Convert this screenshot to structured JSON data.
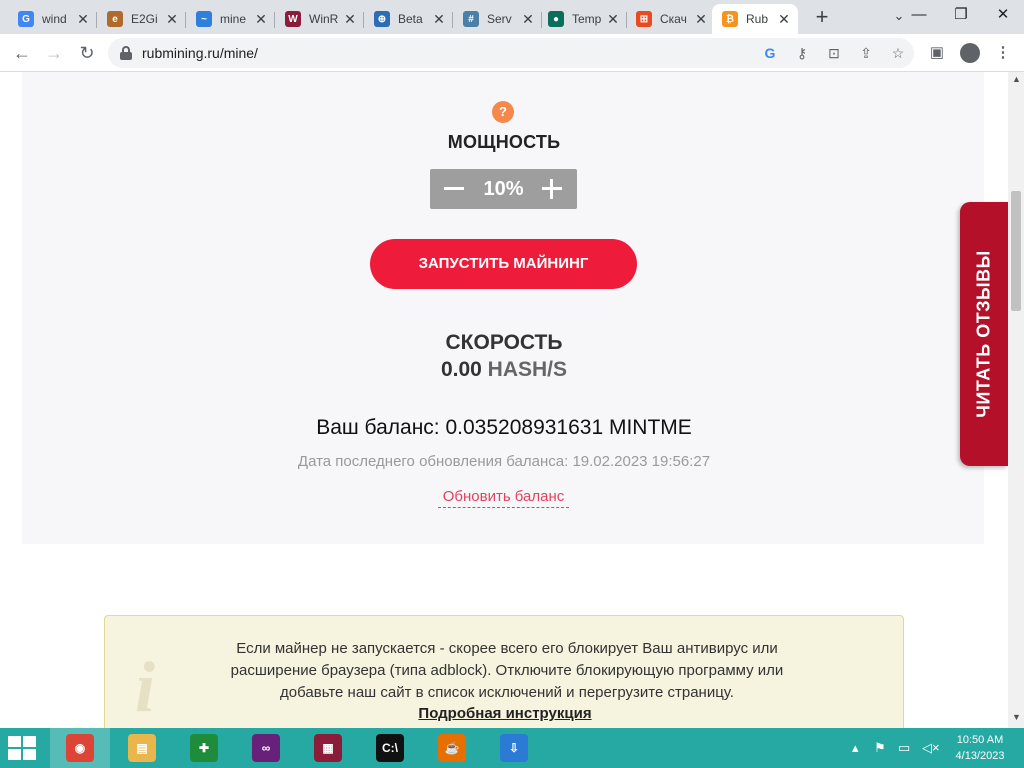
{
  "browser": {
    "tabs": [
      {
        "label": "wind",
        "favicon": "google-g-icon",
        "color": "#4285f4",
        "glyph": "G"
      },
      {
        "label": "E2Gi",
        "favicon": "globe-icon",
        "color": "#b06a2c",
        "glyph": "e"
      },
      {
        "label": "mine",
        "favicon": "swirl-icon",
        "color": "#2f7fdc",
        "glyph": "~"
      },
      {
        "label": "WinR",
        "favicon": "winrar-icon",
        "color": "#8b1d3a",
        "glyph": "W"
      },
      {
        "label": "Beta",
        "favicon": "globe-icon",
        "color": "#2d6db5",
        "glyph": "⊕"
      },
      {
        "label": "Serv",
        "favicon": "grid-icon",
        "color": "#4a7fa8",
        "glyph": "#"
      },
      {
        "label": "Temp",
        "favicon": "teal-circle-icon",
        "color": "#0b6e5a",
        "glyph": "●"
      },
      {
        "label": "Скач",
        "favicon": "windows-logo-icon",
        "color": "#e84b1f",
        "glyph": "⊞"
      },
      {
        "label": "Rub",
        "favicon": "bitcoin-icon",
        "color": "#f7931a",
        "glyph": "₿",
        "active": true
      }
    ],
    "url": "rubmining.ru/mine/"
  },
  "page": {
    "help_glyph": "?",
    "power_label": "МОЩНОСТЬ",
    "power_value": "10%",
    "start_button": "ЗАПУСТИТЬ МАЙНИНГ",
    "speed_label": "СКОРОСТЬ",
    "speed_value": "0.00",
    "speed_unit": "HASH/S",
    "balance": "Ваш баланс: 0.035208931631 MINTME",
    "balance_updated": "Дата последнего обновления баланса: 19.02.2023 19:56:27",
    "refresh_link": "Обновить баланс",
    "notice_text": "Если майнер не запускается - скорее всего его блокирует Ваш антивирус или расширение браузера (типа adblock). Отключите блокирующую программу или добавьте наш сайт в список исключений и перегрузите страницу.",
    "notice_link": "Подробная инструкция",
    "reviews_tab": "ЧИТАТЬ ОТЗЫВЫ"
  },
  "taskbar": {
    "apps": [
      {
        "name": "chrome",
        "color": "#db4437",
        "glyph": "◉",
        "active": true
      },
      {
        "name": "file-explorer",
        "color": "#e8b64a",
        "glyph": "▤"
      },
      {
        "name": "games",
        "color": "#1e8c3a",
        "glyph": "✚"
      },
      {
        "name": "visual-studio",
        "color": "#68217a",
        "glyph": "∞"
      },
      {
        "name": "winrar",
        "color": "#8b1d3a",
        "glyph": "▦"
      },
      {
        "name": "command-prompt",
        "color": "#111111",
        "glyph": "C:\\"
      },
      {
        "name": "java",
        "color": "#e76f00",
        "glyph": "☕"
      },
      {
        "name": "app-installer",
        "color": "#2b7bd6",
        "glyph": "⇩"
      }
    ],
    "time": "10:50 AM",
    "date": "4/13/2023"
  }
}
